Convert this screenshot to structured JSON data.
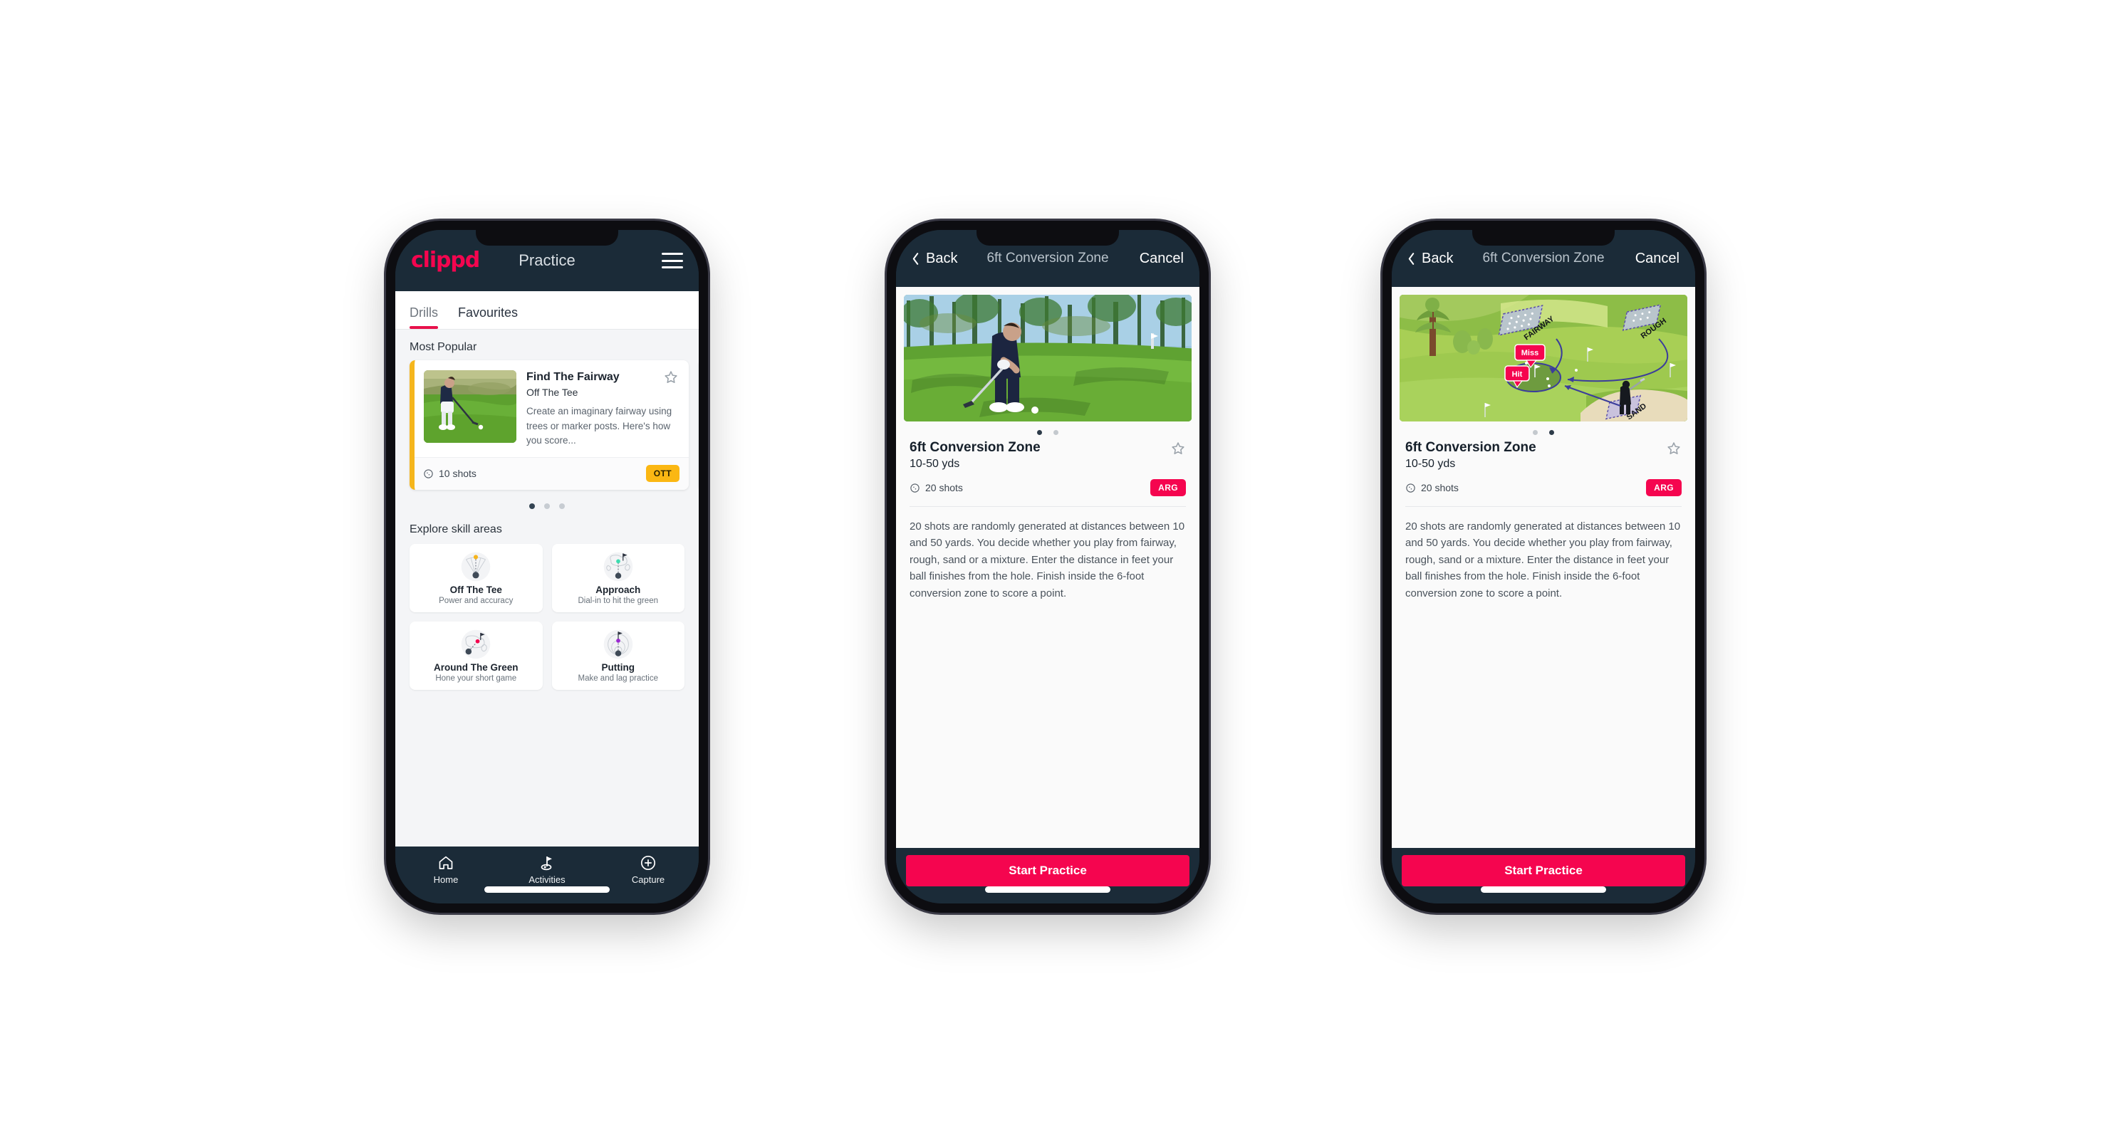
{
  "phone1": {
    "appbar": {
      "logo": "clippd",
      "title": "Practice",
      "menu_icon": "hamburger-icon"
    },
    "tabs": [
      {
        "label": "Drills",
        "active": true
      },
      {
        "label": "Favourites",
        "active": false
      }
    ],
    "sections": {
      "most_popular": "Most Popular",
      "explore": "Explore skill areas"
    },
    "drill_card": {
      "title": "Find The Fairway",
      "category": "Off The Tee",
      "description": "Create an imaginary fairway using trees or marker posts. Here's how you score...",
      "shots": "10 shots",
      "badge": "OTT",
      "badge_color": "#fbb713",
      "accent_color": "#f5b61d",
      "star_icon": "star-outline-icon",
      "clock_icon": "shots-clock-icon"
    },
    "next_card_accent": "#3ddcb0",
    "carousel_dots": {
      "count": 3,
      "active": 0
    },
    "skill_areas": [
      {
        "name": "Off The Tee",
        "sub": "Power and accuracy",
        "icon": "off-the-tee-icon",
        "dot_color": "#f6b41d"
      },
      {
        "name": "Approach",
        "sub": "Dial-in to hit the green",
        "icon": "approach-icon",
        "dot_color": "#3ddcb0"
      },
      {
        "name": "Around The Green",
        "sub": "Hone your short game",
        "icon": "around-the-green-icon",
        "dot_color": "#f5054f"
      },
      {
        "name": "Putting",
        "sub": "Make and lag practice",
        "icon": "putting-icon",
        "dot_color": "#9b29d1"
      }
    ],
    "bottom_nav": [
      {
        "label": "Home",
        "icon": "home-icon",
        "active": false
      },
      {
        "label": "Activities",
        "icon": "flag-icon",
        "active": true
      },
      {
        "label": "Capture",
        "icon": "plus-circle-icon",
        "active": false
      }
    ]
  },
  "phone2": {
    "appbar": {
      "back": "Back",
      "title": "6ft Conversion Zone",
      "cancel": "Cancel",
      "back_icon": "chevron-left-icon"
    },
    "media": {
      "type": "photo",
      "alt": "golfer-chipping-photo"
    },
    "dots": {
      "count": 2,
      "active": 0
    },
    "detail": {
      "title": "6ft Conversion Zone",
      "yards": "10-50 yds",
      "shots": "20 shots",
      "badge": "ARG",
      "badge_color": "#f5054f",
      "star_icon": "star-outline-icon",
      "clock_icon": "shots-clock-icon",
      "description": "20 shots are randomly generated at distances between 10 and 50 yards. You decide whether you play from fairway, rough, sand or a mixture. Enter the distance in feet your ball finishes from the hole. Finish inside the 6-foot conversion zone to score a point."
    },
    "cta": {
      "label": "Start Practice",
      "color": "#f5054f"
    }
  },
  "phone3": {
    "appbar": {
      "back": "Back",
      "title": "6ft Conversion Zone",
      "cancel": "Cancel",
      "back_icon": "chevron-left-icon"
    },
    "media": {
      "type": "illustration",
      "alt": "golf-hole-diagram",
      "labels": [
        "FAIRWAY",
        "ROUGH",
        "SAND"
      ],
      "markers": [
        {
          "text": "Miss",
          "color": "#f5054f"
        },
        {
          "text": "Hit",
          "color": "#f5054f"
        }
      ]
    },
    "dots": {
      "count": 2,
      "active": 1
    },
    "detail": {
      "title": "6ft Conversion Zone",
      "yards": "10-50 yds",
      "shots": "20 shots",
      "badge": "ARG",
      "badge_color": "#f5054f",
      "star_icon": "star-outline-icon",
      "clock_icon": "shots-clock-icon",
      "description": "20 shots are randomly generated at distances between 10 and 50 yards. You decide whether you play from fairway, rough, sand or a mixture. Enter the distance in feet your ball finishes from the hole. Finish inside the 6-foot conversion zone to score a point."
    },
    "cta": {
      "label": "Start Practice",
      "color": "#f5054f"
    }
  },
  "theme": {
    "brand_pink": "#f5054f",
    "dark_navy": "#1b2b38",
    "page_bg": "#ffffff",
    "surface": "#ffffff",
    "app_bg": "#f4f5f7"
  }
}
